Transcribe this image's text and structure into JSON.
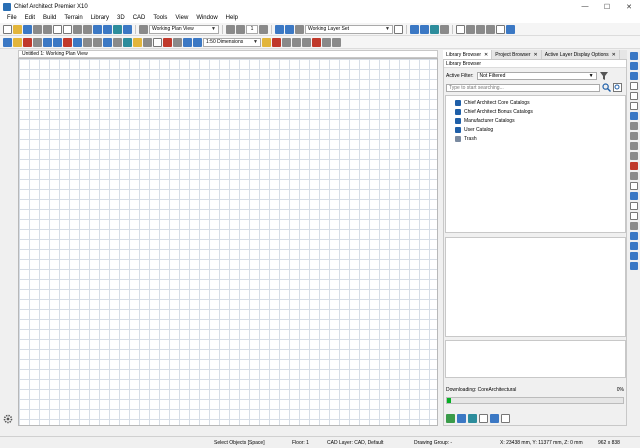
{
  "window": {
    "title": "Chief Architect Premier X10",
    "minimize": "—",
    "maximize": "☐",
    "close": "✕"
  },
  "menu": [
    "File",
    "Edit",
    "Build",
    "Terrain",
    "Library",
    "3D",
    "CAD",
    "Tools",
    "View",
    "Window",
    "Help"
  ],
  "toolbar": {
    "plan_view": "Working Plan View",
    "floor_value": "1",
    "layer_set": "Working Layer Set",
    "dimension_set": "1:50 Dimensions"
  },
  "document": {
    "tab_label": "Untitled 1:  Working Plan View"
  },
  "panel": {
    "tabs": [
      {
        "label": "Library Browser",
        "close": "✕"
      },
      {
        "label": "Project Browser",
        "close": "✕"
      },
      {
        "label": "Active Layer Display Options",
        "close": "✕"
      }
    ],
    "title": "Library Browser",
    "filter_label": "Active Filter:",
    "filter_value": "Not Filtered",
    "search_placeholder": "Type to start searching...",
    "tree": [
      {
        "label": "Chief Architect Core Catalogs",
        "icon": "catalog-icon"
      },
      {
        "label": "Chief Architect Bonus Catalogs",
        "icon": "catalog-icon"
      },
      {
        "label": "Manufacturer Catalogs",
        "icon": "catalog-icon"
      },
      {
        "label": "User Catalog",
        "icon": "catalog-icon"
      },
      {
        "label": "Trash",
        "icon": "trash-icon"
      }
    ],
    "download_label": "Downloading:  CoreArchitectural",
    "download_pct": "0%",
    "download_progress": 0.02
  },
  "status": {
    "mode": "Select Objects [Space]",
    "floor": "Floor: 1",
    "cad_layer": "CAD Layer: CAD,  Default",
    "drawing_group": "Drawing Group: -",
    "coords": "X: 23438 mm, Y: 11377 mm, Z: 0 mm",
    "size": "962 x 838"
  },
  "colors": {
    "accent": "#3b78c4",
    "grid": "#d6dde6",
    "progress": "#06b025"
  }
}
